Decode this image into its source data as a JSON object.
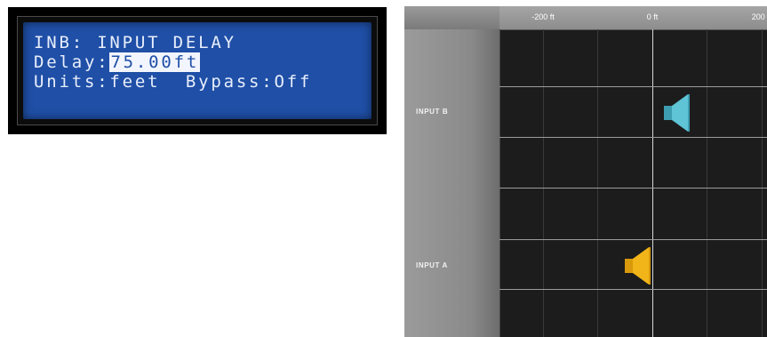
{
  "lcd": {
    "line1": "INB: INPUT DELAY",
    "delay_label": "Delay:",
    "delay_value": "75.00ft",
    "line3": "Units:feet  Bypass:Off"
  },
  "delay_panel": {
    "ticks": [
      "-200 ft",
      "0 ft",
      "200 ft"
    ],
    "inputs": [
      {
        "label": "INPUT B",
        "delay_ft": 75,
        "color": "#5ec4d6"
      },
      {
        "label": "INPUT A",
        "delay_ft": -75,
        "color": "#f2b519"
      }
    ]
  }
}
